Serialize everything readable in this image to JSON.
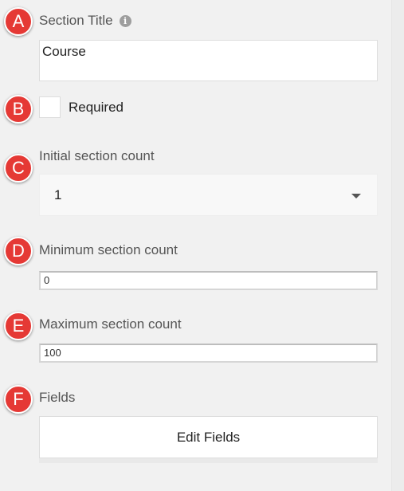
{
  "markers": [
    "A",
    "B",
    "C",
    "D",
    "E",
    "F"
  ],
  "section_title": {
    "label": "Section Title",
    "info_icon": "info-icon",
    "value": "Course"
  },
  "required": {
    "label": "Required",
    "checked": false
  },
  "initial_count": {
    "label": "Initial section count",
    "selected": "1"
  },
  "minimum_count": {
    "label": "Minimum section count",
    "value": "0"
  },
  "maximum_count": {
    "label": "Maximum section count",
    "value": "100"
  },
  "fields": {
    "label": "Fields",
    "button_label": "Edit Fields"
  },
  "colors": {
    "marker": "#e53935",
    "background": "#f1f1f1",
    "label": "#555555"
  }
}
